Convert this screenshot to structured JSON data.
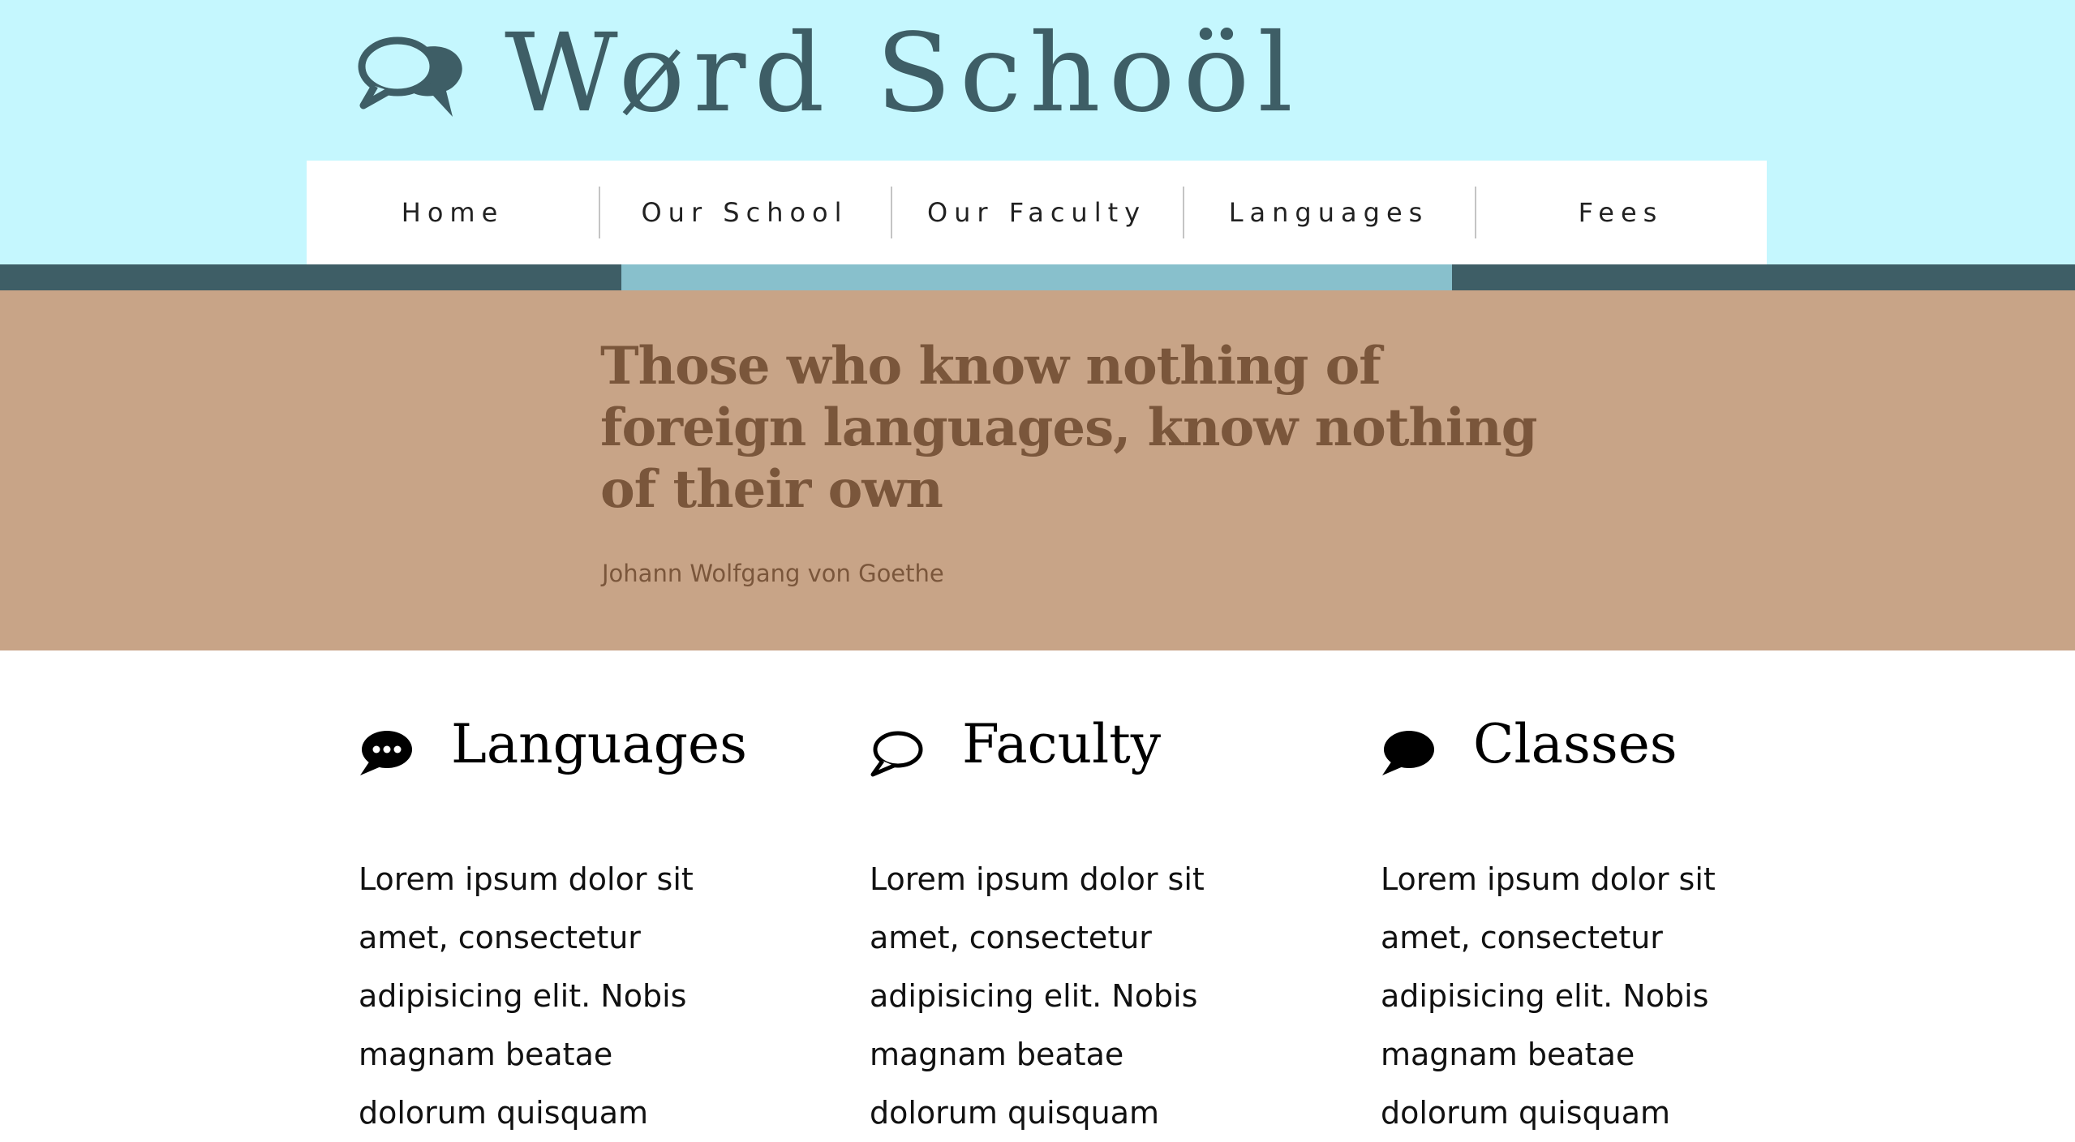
{
  "brand": {
    "title": "Wørd Schoöl",
    "icon": "speech-bubbles-icon",
    "color": "#3e5e66"
  },
  "nav": {
    "items": [
      {
        "label": "Home"
      },
      {
        "label": "Our School"
      },
      {
        "label": "Our Faculty"
      },
      {
        "label": "Languages"
      },
      {
        "label": "Fees"
      }
    ]
  },
  "hero": {
    "quote": "Those who know nothing of foreign languages, know nothing of their own",
    "author": "Johann Wolfgang von Goethe"
  },
  "features": [
    {
      "title": "Languages",
      "icon": "comment-dots-icon",
      "text": "Lorem ipsum dolor sit amet, consectetur adipisicing elit. Nobis magnam beatae dolorum quisquam"
    },
    {
      "title": "Faculty",
      "icon": "comment-outline-icon",
      "text": "Lorem ipsum dolor sit amet, consectetur adipisicing elit. Nobis magnam beatae dolorum quisquam"
    },
    {
      "title": "Classes",
      "icon": "comment-solid-icon",
      "text": "Lorem ipsum dolor sit amet, consectetur adipisicing elit. Nobis magnam beatae dolorum quisquam"
    }
  ],
  "colors": {
    "header_bg": "#c5f7fe",
    "stripe_dark": "#3e5e66",
    "stripe_accent": "#88c0cc",
    "quote_bg": "#c8a487",
    "quote_text": "#7a563b"
  }
}
